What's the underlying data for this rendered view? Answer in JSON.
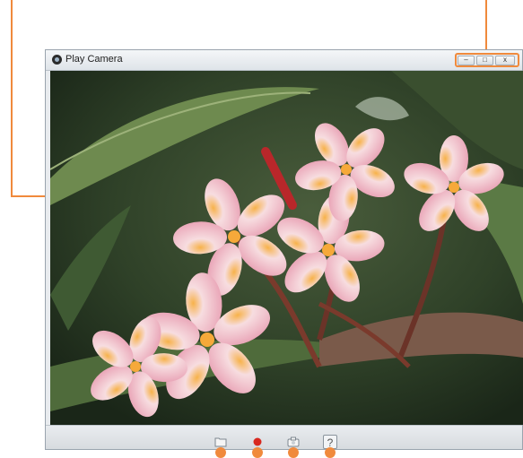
{
  "window": {
    "title": "Play Camera"
  },
  "controls": {
    "minimize_glyph": "–",
    "maximize_glyph": "□",
    "close_glyph": "x"
  },
  "toolbar": {
    "buttons": [
      {
        "name": "folder-icon"
      },
      {
        "name": "record-icon"
      },
      {
        "name": "camera-icon"
      },
      {
        "name": "help-icon",
        "glyph": "?"
      }
    ]
  },
  "colors": {
    "callout": "#f08a3c",
    "record": "#d8281f"
  }
}
